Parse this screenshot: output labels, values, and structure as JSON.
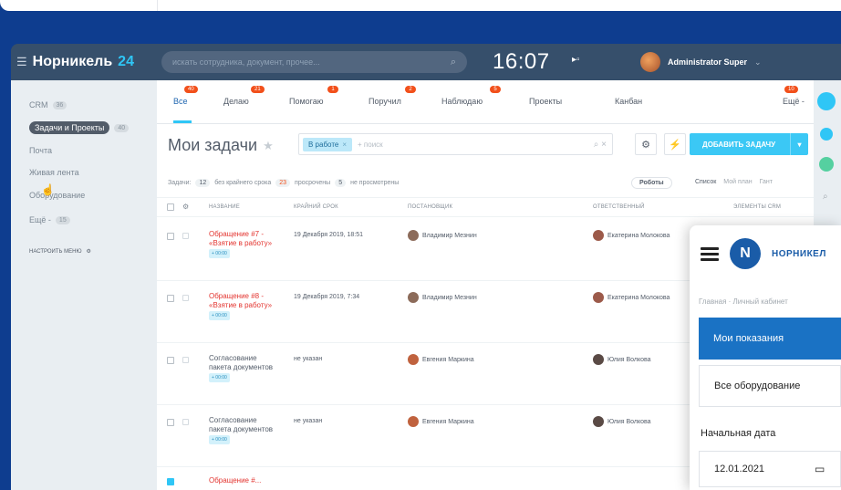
{
  "header": {
    "logo_name": "Норникель",
    "logo_version": "24",
    "search_placeholder": "искать сотрудника, документ, прочее...",
    "clock": "16:07",
    "clock_flag": "▸▫",
    "user_name": "Administrator Super"
  },
  "sidebar": {
    "items": [
      {
        "label": "CRM",
        "badge": "36"
      },
      {
        "label": "Задачи и Проекты",
        "badge": "40"
      },
      {
        "label": "Почта",
        "badge": ""
      },
      {
        "label": "Живая лента",
        "badge": ""
      },
      {
        "label": "Оборудование",
        "badge": ""
      },
      {
        "label": "Ещё -",
        "badge": "15"
      }
    ],
    "settings_label": "НАСТРОИТЬ МЕНЮ"
  },
  "tabs": [
    {
      "label": "Все",
      "count": "40"
    },
    {
      "label": "Делаю",
      "count": "21"
    },
    {
      "label": "Помогаю",
      "count": "1"
    },
    {
      "label": "Поручил",
      "count": "2"
    },
    {
      "label": "Наблюдаю",
      "count": "5"
    },
    {
      "label": "Проекты",
      "count": ""
    },
    {
      "label": "Канбан",
      "count": ""
    },
    {
      "label": "Ещё -",
      "count": "10"
    }
  ],
  "page": {
    "title": "Мои задачи",
    "filter_chip": "В работе",
    "filter_placeholder": "+ поиск",
    "add_button": "ДОБАВИТЬ ЗАДАЧУ"
  },
  "counters": {
    "label": "Задачи:",
    "no_deadline_count": "12",
    "no_deadline_label": "без крайнего срока",
    "overdue_count": "23",
    "overdue_label": "просрочены",
    "unread_count": "5",
    "unread_label": "не просмотрены"
  },
  "view_buttons": {
    "robots": "Роботы",
    "list": "Список",
    "my_plan": "Мой план",
    "gantt": "Гант"
  },
  "table": {
    "columns": [
      "НАЗВАНИЕ",
      "КРАЙНИЙ СРОК",
      "ПОСТАНОВЩИК",
      "ОТВЕТСТВЕННЫЙ",
      "ЭЛЕМЕНТЫ CRM"
    ],
    "rows": [
      {
        "name": "Обращение #7 - «Взятие в работу»",
        "tag": "+ 00:00",
        "deadline": "19 Декабря 2019, 18:51",
        "creator": "Владимир Мезнин",
        "responsible": "Екатерина Молокова",
        "name_style": "red"
      },
      {
        "name": "Обращение #8 - «Взятие в работу»",
        "tag": "+ 00:00",
        "deadline": "19 Декабря 2019, 7:34",
        "creator": "Владимир Мезнин",
        "responsible": "Екатерина Молокова",
        "name_style": "red"
      },
      {
        "name": "Согласование пакета документов",
        "tag": "+ 00:00",
        "deadline": "не указан",
        "creator": "Евгения Маркина",
        "responsible": "Юлия Волкова",
        "name_style": "grey"
      },
      {
        "name": "Согласование пакета документов",
        "tag": "+ 00:00",
        "deadline": "не указан",
        "creator": "Евгения Маркина",
        "responsible": "Юлия Волкова",
        "name_style": "grey"
      },
      {
        "name": "Обращение #...",
        "tag": "",
        "deadline": "",
        "creator": "",
        "responsible": "",
        "name_style": "red"
      }
    ]
  },
  "mobile": {
    "brand": "НОРНИКЕЛ",
    "breadcrumb": "Главная · Личный кабинет",
    "nav_active": "Мои показания",
    "nav_item": "Все оборудование",
    "date_label": "Начальная дата",
    "date_value": "12.01.2021"
  },
  "colors": {
    "background": "#0e3d8f",
    "header": "#364f6b",
    "accent": "#3bc8f5",
    "counter": "#f2501b",
    "mobile_active": "#1a72c4"
  }
}
